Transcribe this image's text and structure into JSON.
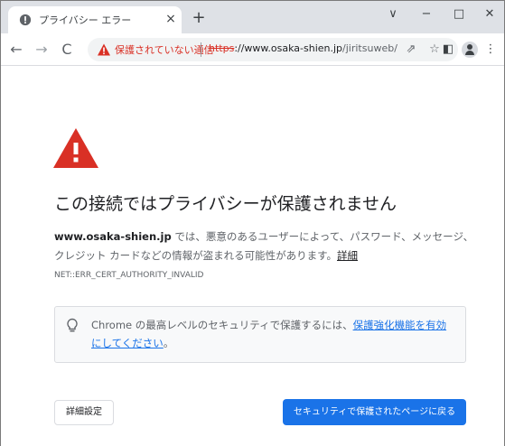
{
  "tab": {
    "title": "プライバシー エラー",
    "close": "×",
    "new_tab": "+"
  },
  "window_controls": {
    "dropdown": "∨",
    "minimize": "−",
    "maximize": "□",
    "close": "✕"
  },
  "toolbar": {
    "back": "←",
    "forward": "→",
    "reload": "C",
    "security_label": "保護されていない通信",
    "url_scheme": "https",
    "url_host": "://www.osaka-shien.jp",
    "url_path": "/jiritsuweb/",
    "share_icon": "⇗",
    "star_icon": "☆",
    "sidepanel_icon": "◧",
    "menu_icon": "⋮"
  },
  "page": {
    "heading": "この接続ではプライバシーが保護されません",
    "domain": "www.osaka-shien.jp",
    "description": " では、悪意のあるユーザーによって、パスワード、メッセージ、クレジット カードなどの情報が盗まれる可能性があります。",
    "details_link": "詳細",
    "error_code": "NET::ERR_CERT_AUTHORITY_INVALID",
    "panel_text": "Chrome の最高レベルのセキュリティで保護するには、",
    "panel_link": "保護強化機能を有効にしてください",
    "panel_tail": "。",
    "advanced_button": "詳細設定",
    "back_button": "セキュリティで保護されたページに戻る"
  },
  "colors": {
    "warning_red": "#d93025",
    "link_blue": "#1a73e8",
    "tab_strip": "#dee1e6"
  }
}
